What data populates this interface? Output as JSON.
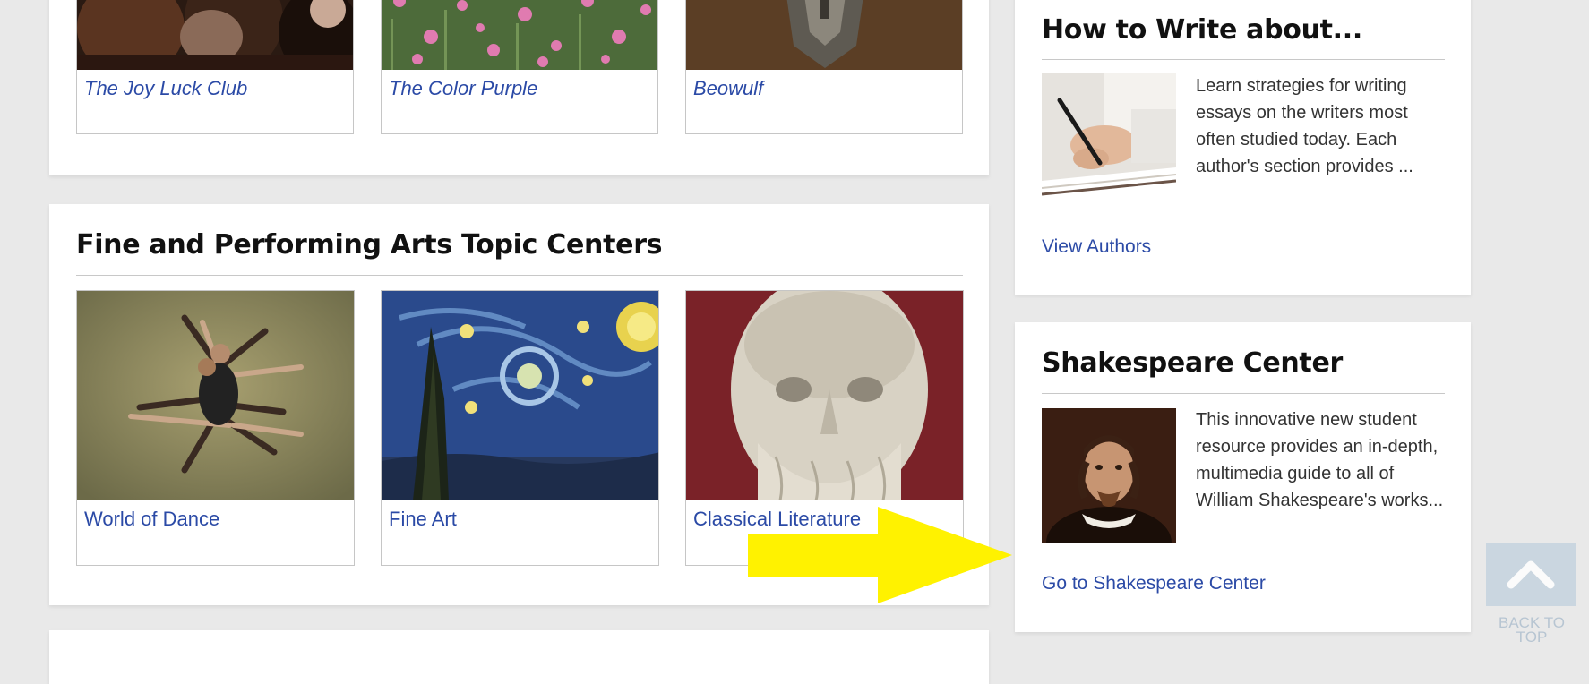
{
  "top_section": {
    "tiles": [
      {
        "label": "The Joy Luck Club"
      },
      {
        "label": "The Color Purple"
      },
      {
        "label": "Beowulf"
      }
    ]
  },
  "arts_section": {
    "title": "Fine and Performing Arts Topic Centers",
    "tiles": [
      {
        "label": "World of Dance"
      },
      {
        "label": "Fine Art"
      },
      {
        "label": "Classical Literature"
      }
    ]
  },
  "how_to_write": {
    "title": "How to Write about...",
    "description": "Learn strategies for writing essays on the writers most often studied today. Each author's section provides ...",
    "link": "View Authors"
  },
  "shakespeare": {
    "title": "Shakespeare Center",
    "description": "This innovative new student resource provides an in-depth, multimedia guide to all of William Shakespeare's works...",
    "link": "Go to Shakespeare Center"
  },
  "back_to_top": {
    "label_line1": "BACK TO",
    "label_line2": "TOP"
  },
  "annotation": {
    "color": "#fff200"
  }
}
